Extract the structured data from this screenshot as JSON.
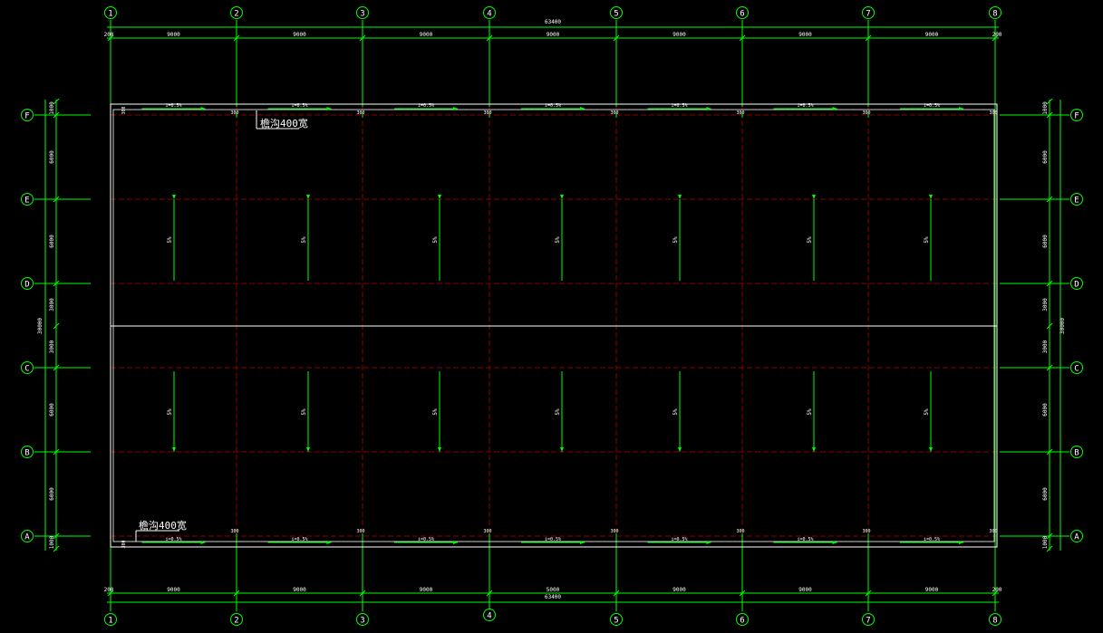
{
  "colors": {
    "background": "#000000",
    "grid_line": "#00ff00",
    "dimension": "#00ff00",
    "dashed_red": "#8b0000",
    "outline": "#ffffff",
    "text": "#ffffff",
    "bubble": "#00ff00"
  },
  "grid": {
    "columns": [
      "1",
      "2",
      "3",
      "4",
      "5",
      "6",
      "7",
      "8"
    ],
    "rows": [
      "F",
      "E",
      "D",
      "C",
      "B",
      "A"
    ]
  },
  "dimensions": {
    "top_total": "63400",
    "bottom_total": "63400",
    "top_spans": [
      "9000",
      "9000",
      "9000",
      "9000",
      "9000",
      "9000",
      "9000"
    ],
    "bottom_spans": [
      "9000",
      "9000",
      "9000",
      "5000",
      "9000",
      "9000",
      "9000"
    ],
    "end_offset": "200",
    "left_total": "30000",
    "right_total": "30000",
    "left_spans": [
      "1000",
      "6000",
      "6000",
      "3000",
      "3000",
      "6000",
      "6000",
      "1000"
    ],
    "right_spans": [
      "1000",
      "6000",
      "6000",
      "3000",
      "3000",
      "6000",
      "6000",
      "1000"
    ]
  },
  "gutter": {
    "top_label": "檐沟400宽",
    "bottom_label": "檐沟400宽",
    "top_slopes": [
      "i=0.5%",
      "i=0.5%",
      "i=0.5%",
      "i=0.5%",
      "i=0.5%",
      "i=0.5%",
      "i=0.5%"
    ],
    "bottom_slopes": [
      "i=0.5%",
      "i=0.5%",
      "i=0.5%",
      "i=0.5%",
      "i=0.5%",
      "i=0.5%",
      "i=0.5%"
    ],
    "downpipe_marks": [
      "300",
      "300",
      "300",
      "300",
      "300",
      "300",
      "300"
    ],
    "edge_marks": [
      "300",
      "300"
    ]
  },
  "roof": {
    "slope_label": "5%",
    "arrows_per_row": 7
  }
}
